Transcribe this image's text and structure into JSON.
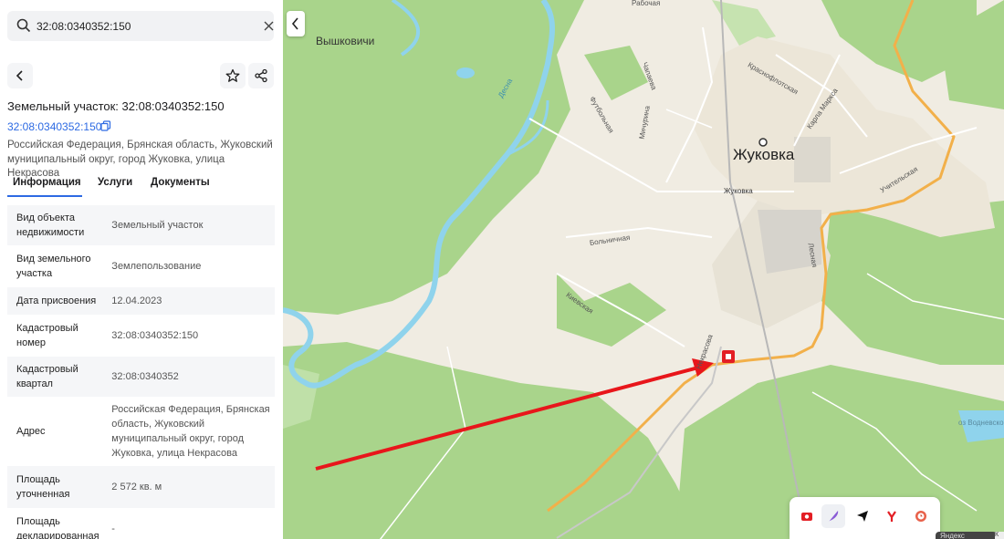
{
  "search": {
    "value": "32:08:0340352:150"
  },
  "header": {
    "title": "Земельный участок: 32:08:0340352:150",
    "number_link": "32:08:0340352:150",
    "address": "Российская Федерация, Брянская область, Жуковский муниципальный округ, город Жуковка, улица Некрасова"
  },
  "tabs": [
    {
      "label": "Информация",
      "active": true
    },
    {
      "label": "Услуги"
    },
    {
      "label": "Документы"
    }
  ],
  "info": [
    {
      "key": "Вид объекта недвижимости",
      "value": "Земельный участок"
    },
    {
      "key": "Вид земельного участка",
      "value": "Землепользование"
    },
    {
      "key": "Дата присвоения",
      "value": "12.04.2023"
    },
    {
      "key": "Кадастровый номер",
      "value": "32:08:0340352:150"
    },
    {
      "key": "Кадастровый квартал",
      "value": "32:08:0340352"
    },
    {
      "key": "Адрес",
      "value": "Российская Федерация, Брянская область, Жуковский муниципальный округ, город Жуковка, улица Некрасова"
    },
    {
      "key": "Площадь уточненная",
      "value": "2 572 кв. м"
    },
    {
      "key": "Площадь декларированная",
      "value": "-"
    }
  ],
  "map": {
    "city": "Жуковка",
    "village": "Вышковичи",
    "station": "Жуковка",
    "lake": "оз Водневское",
    "attribution": "Яндекс",
    "corner": "К",
    "streets": {
      "rabochaya": "Рабочая",
      "chapaeva": "Чапаева",
      "krasnoflotskaya": "Краснофлотская",
      "karla_marksa": "Карла Маркса",
      "futbolnaya": "Футбольная",
      "michurina": "Мичурина",
      "bolnichnaya": "Больничная",
      "kievskaya": "Киевская",
      "nekrasova": "Некрасова",
      "lesnaya": "Лесная",
      "uchitelskaya": "Учительская",
      "desna": "Десна"
    }
  },
  "colors": {
    "accent": "#2d6ae3",
    "forest": "#a9d48b",
    "water": "#8fd3ec",
    "road": "#f2b04a",
    "arrow": "#e8161b",
    "marker": "#e31e24"
  }
}
